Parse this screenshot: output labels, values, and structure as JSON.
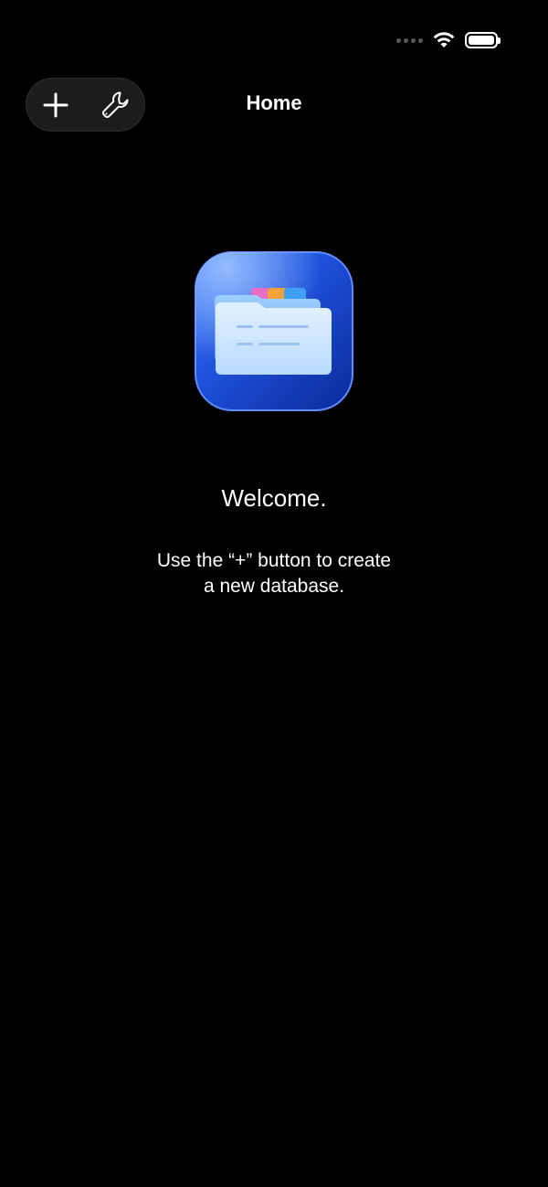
{
  "status_bar": {
    "signal_icon": "signal-dots-icon",
    "wifi_icon": "wifi-icon",
    "battery_icon": "battery-icon",
    "battery_level": 1.0
  },
  "toolbar": {
    "add_icon": "plus-icon",
    "settings_icon": "wrench-icon"
  },
  "nav": {
    "title": "Home"
  },
  "app_icon": {
    "icon": "folder-database-icon"
  },
  "welcome": {
    "title": "Welcome.",
    "line1": "Use the “+” button to create",
    "line2": "a new database."
  },
  "colors": {
    "background": "#000000",
    "text": "#ffffff",
    "pill_background": "#1c1c1e",
    "icon_blue": "#1e4fd8"
  }
}
